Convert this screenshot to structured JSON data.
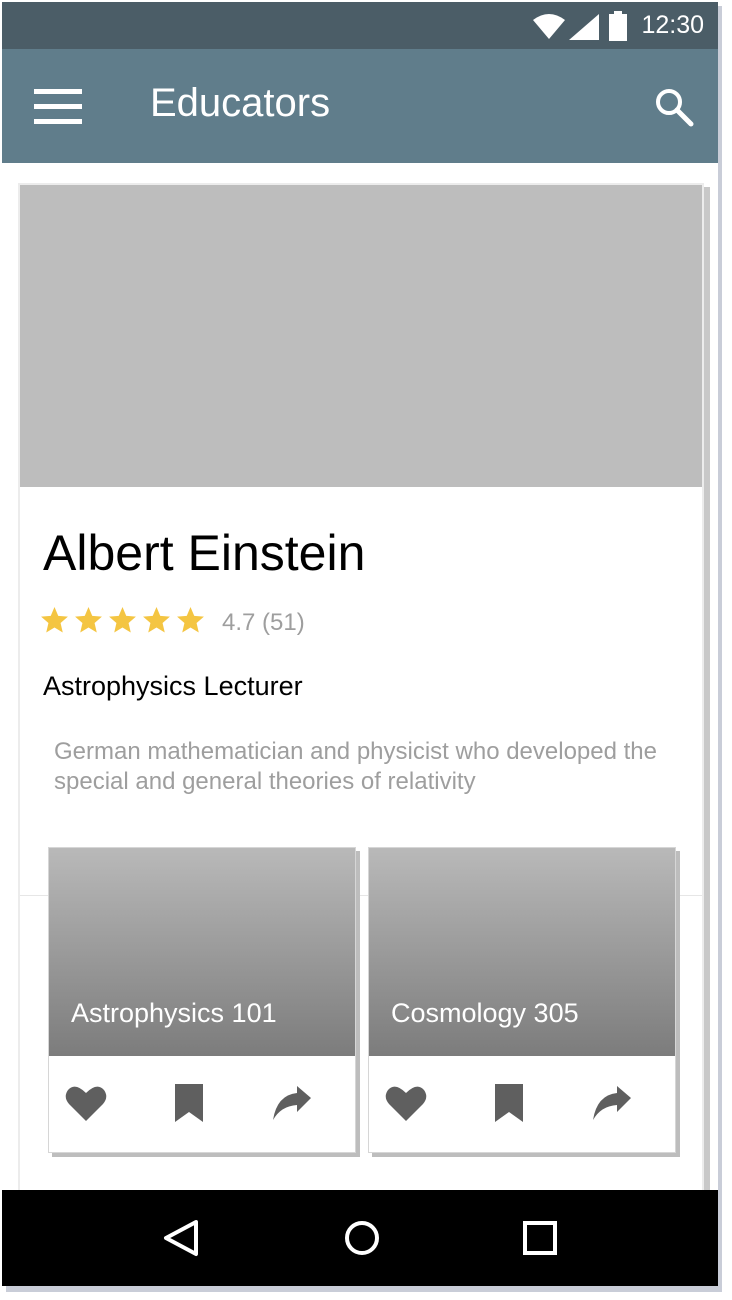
{
  "status_bar": {
    "time": "12:30"
  },
  "app_bar": {
    "title": "Educators"
  },
  "educator": {
    "name": "Albert Einstein",
    "rating_stars": 5,
    "rating_text": "4.7 (51)",
    "role": "Astrophysics Lecturer",
    "description": "German mathematician and physicist who developed the special and general theories of relativity"
  },
  "courses": [
    {
      "title": "Astrophysics 101",
      "actions": [
        "heart-icon",
        "bookmark-icon",
        "share-icon"
      ]
    },
    {
      "title": "Cosmology 305",
      "actions": [
        "heart-icon",
        "bookmark-icon",
        "share-icon"
      ]
    }
  ],
  "icons": {
    "status": [
      "wifi-icon",
      "signal-icon",
      "battery-icon"
    ],
    "app_bar": [
      "menu-icon",
      "search-icon"
    ],
    "nav": [
      "back-icon",
      "home-icon",
      "recents-icon"
    ]
  },
  "colors": {
    "status_bar": "#4b5d67",
    "app_bar": "#607d8b",
    "star": "#f4c542",
    "icon_gray": "#5f5f5f"
  }
}
